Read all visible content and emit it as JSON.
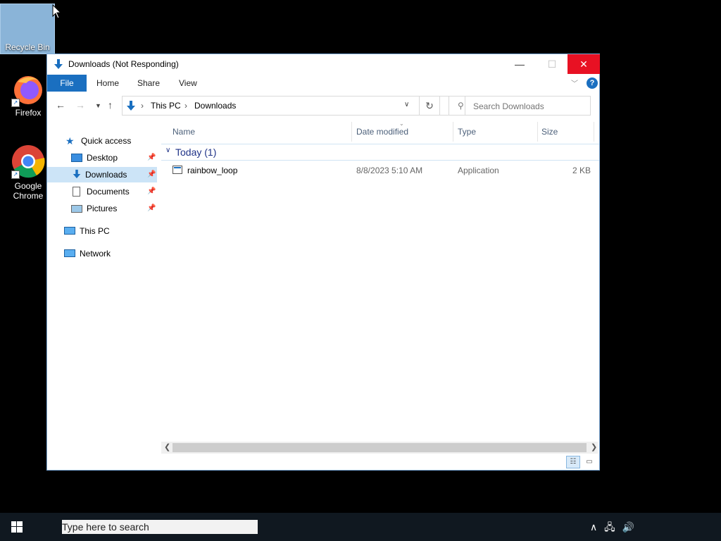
{
  "desktop": {
    "icons": [
      {
        "label": "Recycle Bin"
      },
      {
        "label": "Firefox"
      },
      {
        "label": "Google Chrome"
      }
    ]
  },
  "window": {
    "title": "Downloads (Not Responding)",
    "controls": {
      "minimize": "—",
      "maximize": "☐",
      "close": "✕"
    },
    "ribbon_tabs": [
      "File",
      "Home",
      "Share",
      "View"
    ],
    "help": "?",
    "address": {
      "crumbs": [
        "This PC",
        "Downloads"
      ],
      "separator": "›"
    },
    "search": {
      "placeholder": "Search Downloads"
    },
    "nav_pane": {
      "quick_access": "Quick access",
      "items": [
        "Desktop",
        "Downloads",
        "Documents",
        "Pictures"
      ],
      "this_pc": "This PC",
      "network": "Network"
    },
    "columns": [
      "Name",
      "Date modified",
      "Type",
      "Size"
    ],
    "group": {
      "label": "Today (1)"
    },
    "files": [
      {
        "name": "rainbow_loop",
        "date": "8/8/2023 5:10 AM",
        "type": "Application",
        "size": "2 KB"
      }
    ]
  },
  "taskbar": {
    "search_placeholder": "Type here to search"
  },
  "colors": {
    "accent": "#1a6fc0",
    "close_red": "#e81123",
    "taskbar": "#101820",
    "selection": "#cce4f7"
  }
}
